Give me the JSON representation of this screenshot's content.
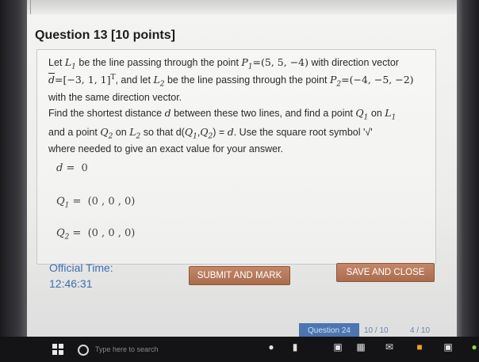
{
  "question": {
    "title": "Question 13 [10 points]",
    "line1_a": "Let ",
    "line1_L1": "L",
    "line1_L1_sub": "1",
    "line1_b": " be the line passing through the point ",
    "line1_P1": "P",
    "line1_P1_sub": "1",
    "line1_P1_val": "=(5, 5, −4)",
    "line1_c": " with direction vector",
    "line2_d": "d",
    "line2_dval": "=[−3, 1, 1]",
    "line2_T": "T",
    "line2_a": ", and let ",
    "line2_L2": "L",
    "line2_L2_sub": "2",
    "line2_b": " be the line passing through the point ",
    "line2_P2": "P",
    "line2_P2_sub": "2",
    "line2_P2_val": "=(−4, −5, −2)",
    "line3": "with the same direction vector.",
    "line4_a": "Find the shortest distance ",
    "line4_d": "d",
    "line4_b": " between these two lines, and find a point ",
    "line4_Q1": "Q",
    "line4_Q1_sub": "1",
    "line4_c": " on ",
    "line4_L1": "L",
    "line4_L1_sub": "1",
    "line5_a": "and a point ",
    "line5_Q2": "Q",
    "line5_Q2_sub": "2",
    "line5_b": " on ",
    "line5_L2": "L",
    "line5_L2_sub": "2",
    "line5_c": " so that d(",
    "line5_Q1": "Q",
    "line5_Q1_sub": "1",
    "line5_comma": ",",
    "line5_Q2b": "Q",
    "line5_Q2b_sub": "2",
    "line5_d": ") = ",
    "line5_dd": "d",
    "line5_e": ". Use the square root symbol '√'",
    "line6": "where needed to give an exact value for your answer."
  },
  "answers": {
    "d_label": "d",
    "d_eq": " = ",
    "d_value": "0",
    "q1_label": "Q",
    "q1_sub": "1",
    "q1_eq": " = ",
    "q1_value": "(0 , 0 , 0)",
    "q2_label": "Q",
    "q2_sub": "2",
    "q2_eq": " = ",
    "q2_value": "(0 , 0 , 0)"
  },
  "footer": {
    "official_label": "Official Time:",
    "official_time": "12:46:31",
    "submit_label": "SUBMIT AND MARK",
    "save_label": "SAVE AND CLOSE"
  },
  "nav": {
    "question_tab": "Question 24",
    "count1": "10 / 10",
    "count2": "4 / 10"
  },
  "taskbar": {
    "search_placeholder": "Type here to search"
  }
}
